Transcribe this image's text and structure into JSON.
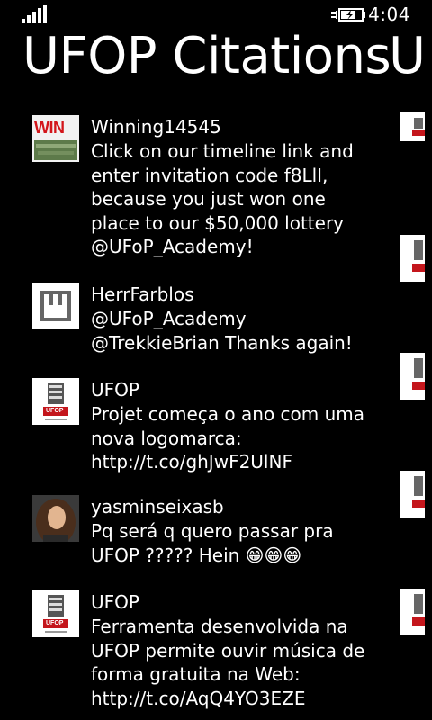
{
  "status": {
    "time": "4:04"
  },
  "page": {
    "title": "UFOP Citations",
    "next_title": "U"
  },
  "tweets": [
    {
      "author": "Winning14545",
      "text": "Click on our timeline link and enter invitation code f8LlI, because you just won one place to our $50,000 lottery @UFoP_Academy!",
      "avatar": "win-logo",
      "avatar_text": "WIN"
    },
    {
      "author": "HerrFarblos",
      "text": "@UFoP_Academy @TrekkieBrian Thanks again!",
      "avatar": "box-logo"
    },
    {
      "author": "UFOP",
      "text": "Projet começa o ano com uma nova logomarca: http://t.co/ghJwF2UlNF",
      "avatar": "ufop-logo",
      "avatar_text": "UFOP"
    },
    {
      "author": "yasminseixasb",
      "text": "Pq será q quero passar pra UFOP ????? Hein 😁😁😁",
      "avatar": "user-photo"
    },
    {
      "author": "UFOP",
      "text": "Ferramenta desenvolvida na UFOP permite ouvir música de forma gratuita na Web: http://t.co/AqQ4YO3EZE",
      "avatar": "ufop-logo",
      "avatar_text": "UFOP"
    }
  ],
  "colors": {
    "background": "#000000",
    "text": "#ffffff",
    "win_red": "#d3161b",
    "ufop_red": "#c4161c"
  }
}
